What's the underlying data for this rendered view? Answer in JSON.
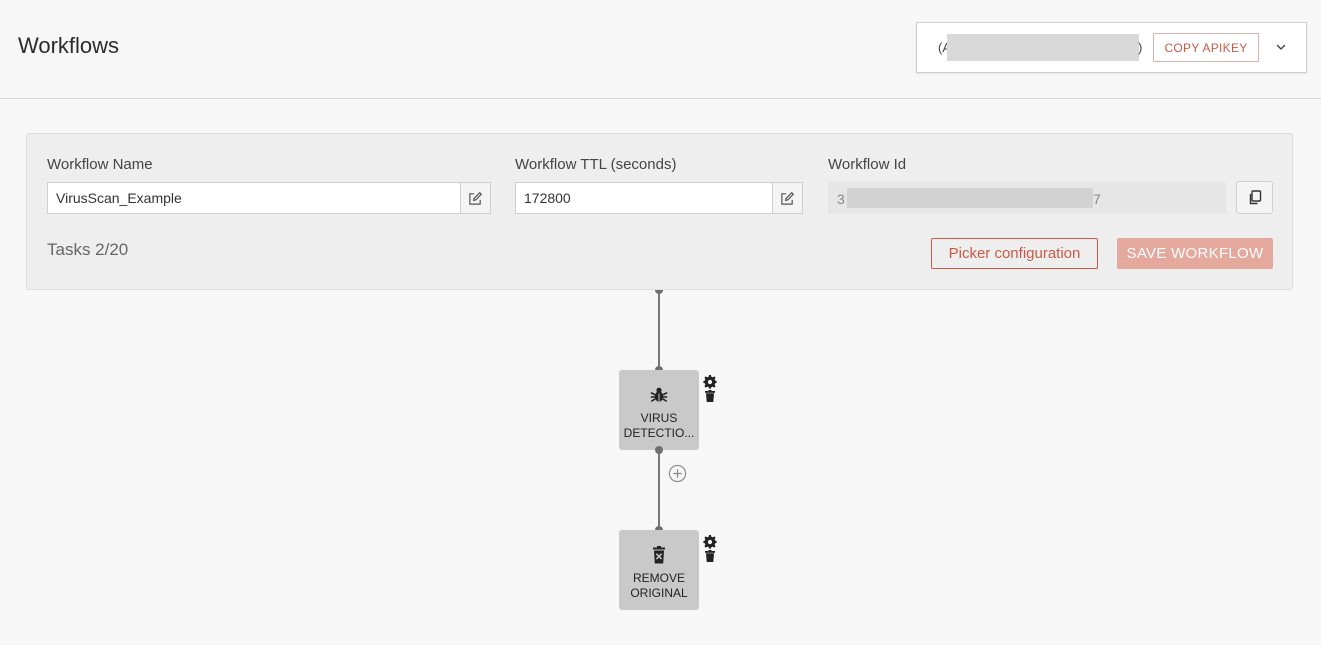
{
  "header": {
    "title": "Workflows",
    "apikey": {
      "open_text": "(A",
      "masked_value": "redacted",
      "close_text": ")",
      "copy_label": "COPY APIKEY"
    }
  },
  "workflow": {
    "name_label": "Workflow Name",
    "name_value": "VirusScan_Example",
    "ttl_label": "Workflow TTL (seconds)",
    "ttl_value": "172800",
    "id_label": "Workflow Id",
    "id_first": "3",
    "id_masked": "redacted",
    "id_last": "7",
    "tasks_count": "Tasks 2/20",
    "picker_label": "Picker configuration",
    "save_label": "SAVE WORKFLOW"
  },
  "graph": {
    "nodes": [
      {
        "label_line1": "VIRUS",
        "label_line2": "DETECTIO...",
        "icon": "bug-icon"
      },
      {
        "label_line1": "REMOVE",
        "label_line2": "ORIGINAL",
        "icon": "trash-x-icon"
      }
    ]
  },
  "colors": {
    "accent": "#c85a45",
    "accent_disabled": "#e4a89c",
    "node_bg": "#c9c9c9",
    "page_bg": "#f7f7f7"
  }
}
